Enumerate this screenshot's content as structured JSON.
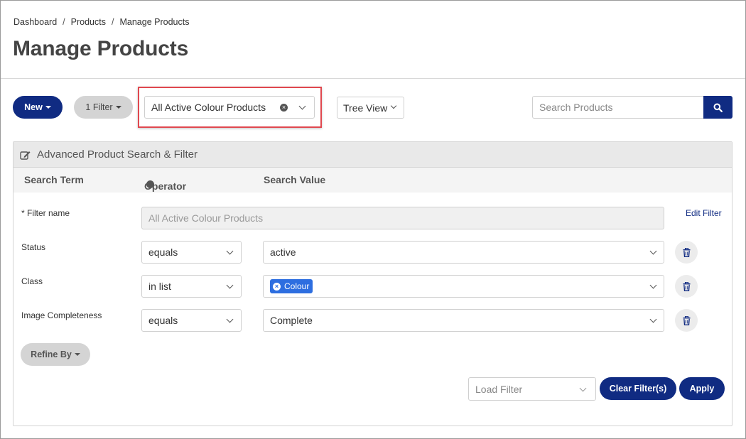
{
  "breadcrumb": [
    "Dashboard",
    "Products",
    "Manage Products"
  ],
  "page_title": "Manage Products",
  "toolbar": {
    "new_label": "New",
    "filter_count_label": "1 Filter",
    "saved_filter_value": "All Active Colour Products",
    "view_label": "Tree View",
    "search_placeholder": "Search Products"
  },
  "panel": {
    "title": "Advanced Product Search & Filter",
    "columns": [
      "Search Term",
      "Operator",
      "Search Value"
    ],
    "filter_name_label": "* Filter name",
    "filter_name_value": "All Active Colour Products",
    "edit_filter_label": "Edit Filter",
    "rows": [
      {
        "term": "Status",
        "operator": "equals",
        "value": "active"
      },
      {
        "term": "Class",
        "operator": "in list",
        "tag": "Colour"
      },
      {
        "term": "Image Completeness",
        "operator": "equals",
        "value": "Complete"
      }
    ],
    "refine_label": "Refine By",
    "load_filter_placeholder": "Load Filter",
    "clear_label": "Clear Filter(s)",
    "apply_label": "Apply"
  },
  "colors": {
    "primary": "#102b82",
    "highlight": "#e0484f",
    "tag": "#2d6ee0"
  }
}
